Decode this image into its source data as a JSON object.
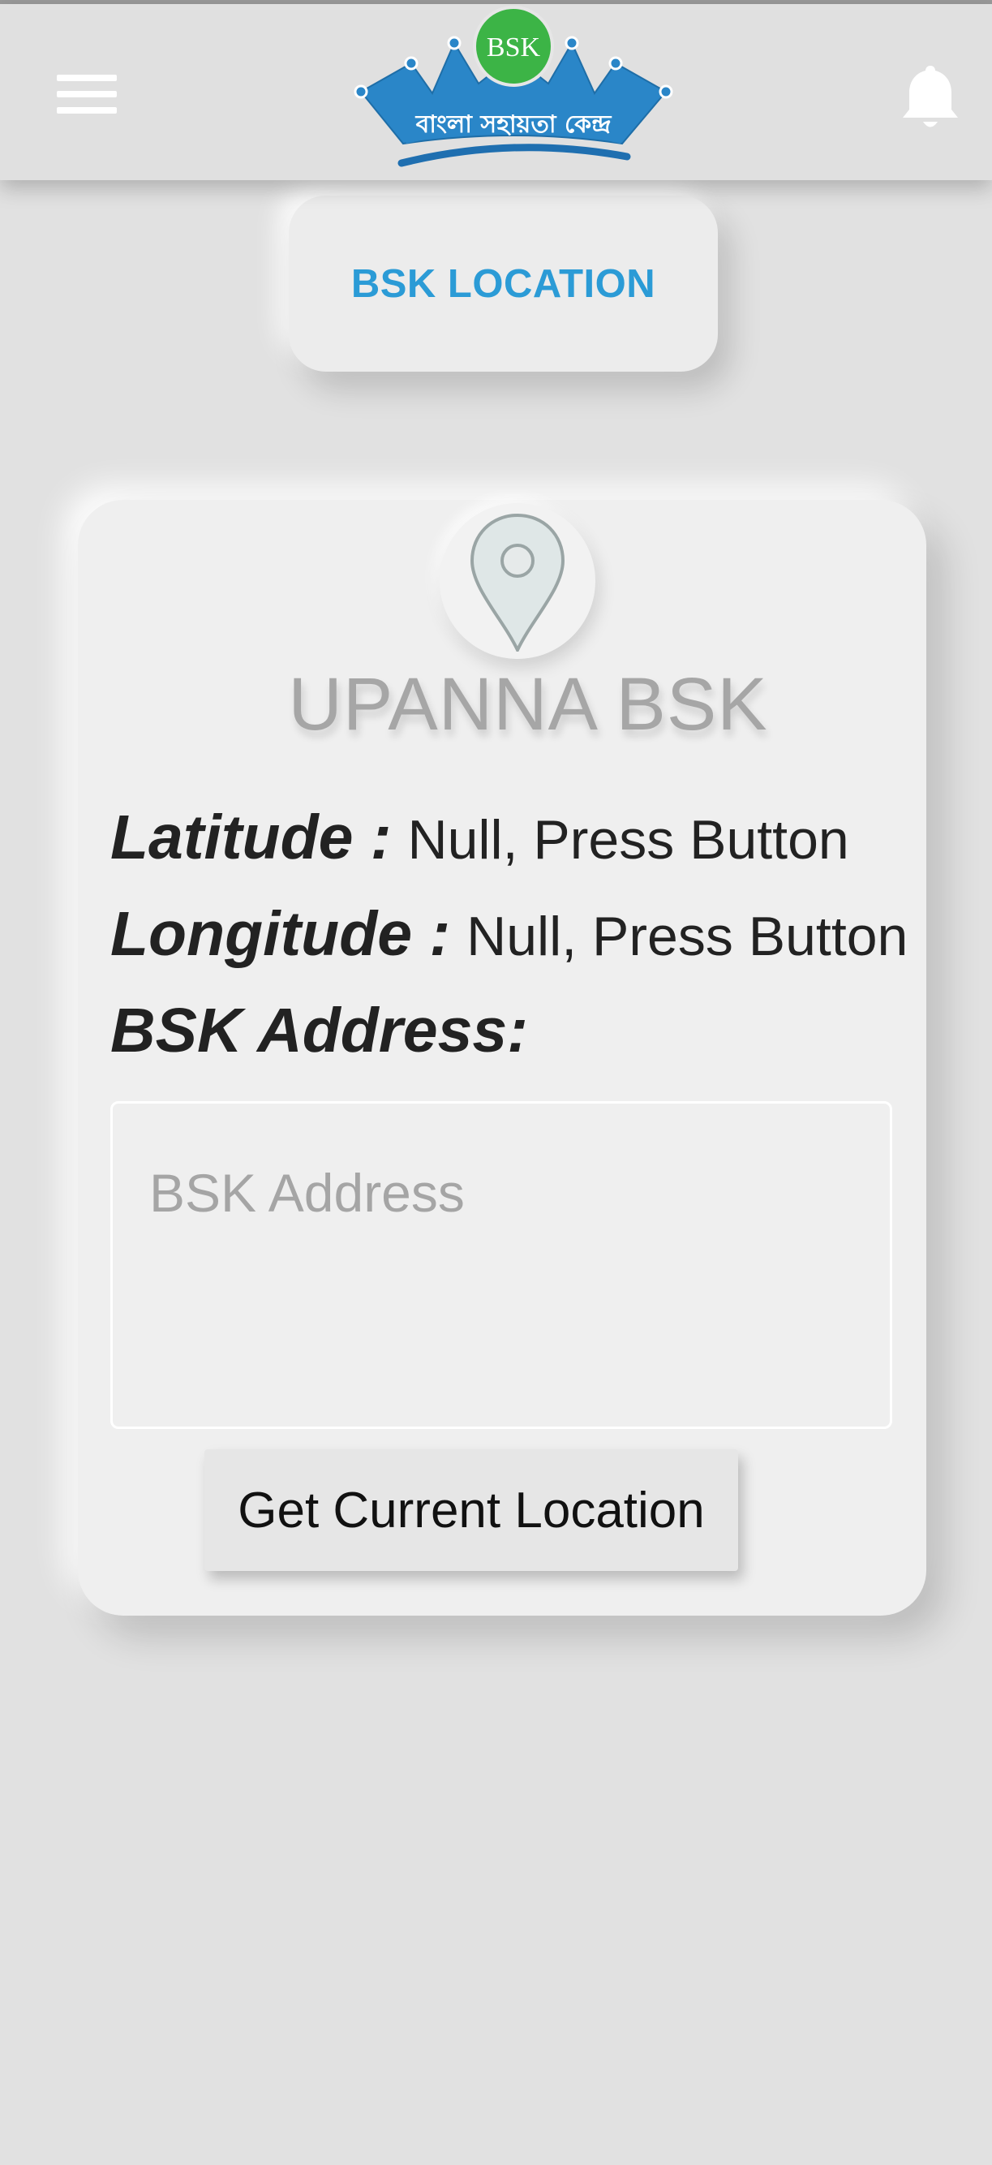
{
  "header": {
    "menu_icon": "hamburger-menu-icon",
    "logo": {
      "badge_text": "BSK",
      "bengali_text": "বাংলা সহায়তা কেন্দ্র",
      "crown_color": "#2a86c8",
      "badge_color": "#3cb446"
    },
    "notification_icon": "bell-icon"
  },
  "page_title": "BSK LOCATION",
  "location_card": {
    "pin_icon": "map-pin-icon",
    "bsk_name": "UPANNA BSK",
    "latitude_label": "Latitude :",
    "latitude_value": "Null, Press Button",
    "longitude_label": "Longitude :",
    "longitude_value": "Null, Press Button",
    "address_label": "BSK Address:",
    "address_value": "",
    "address_placeholder": "BSK Address",
    "get_location_button": "Get Current Location"
  },
  "colors": {
    "accent": "#2b9bd6",
    "background": "#e1e1e1",
    "card": "#efefef"
  }
}
